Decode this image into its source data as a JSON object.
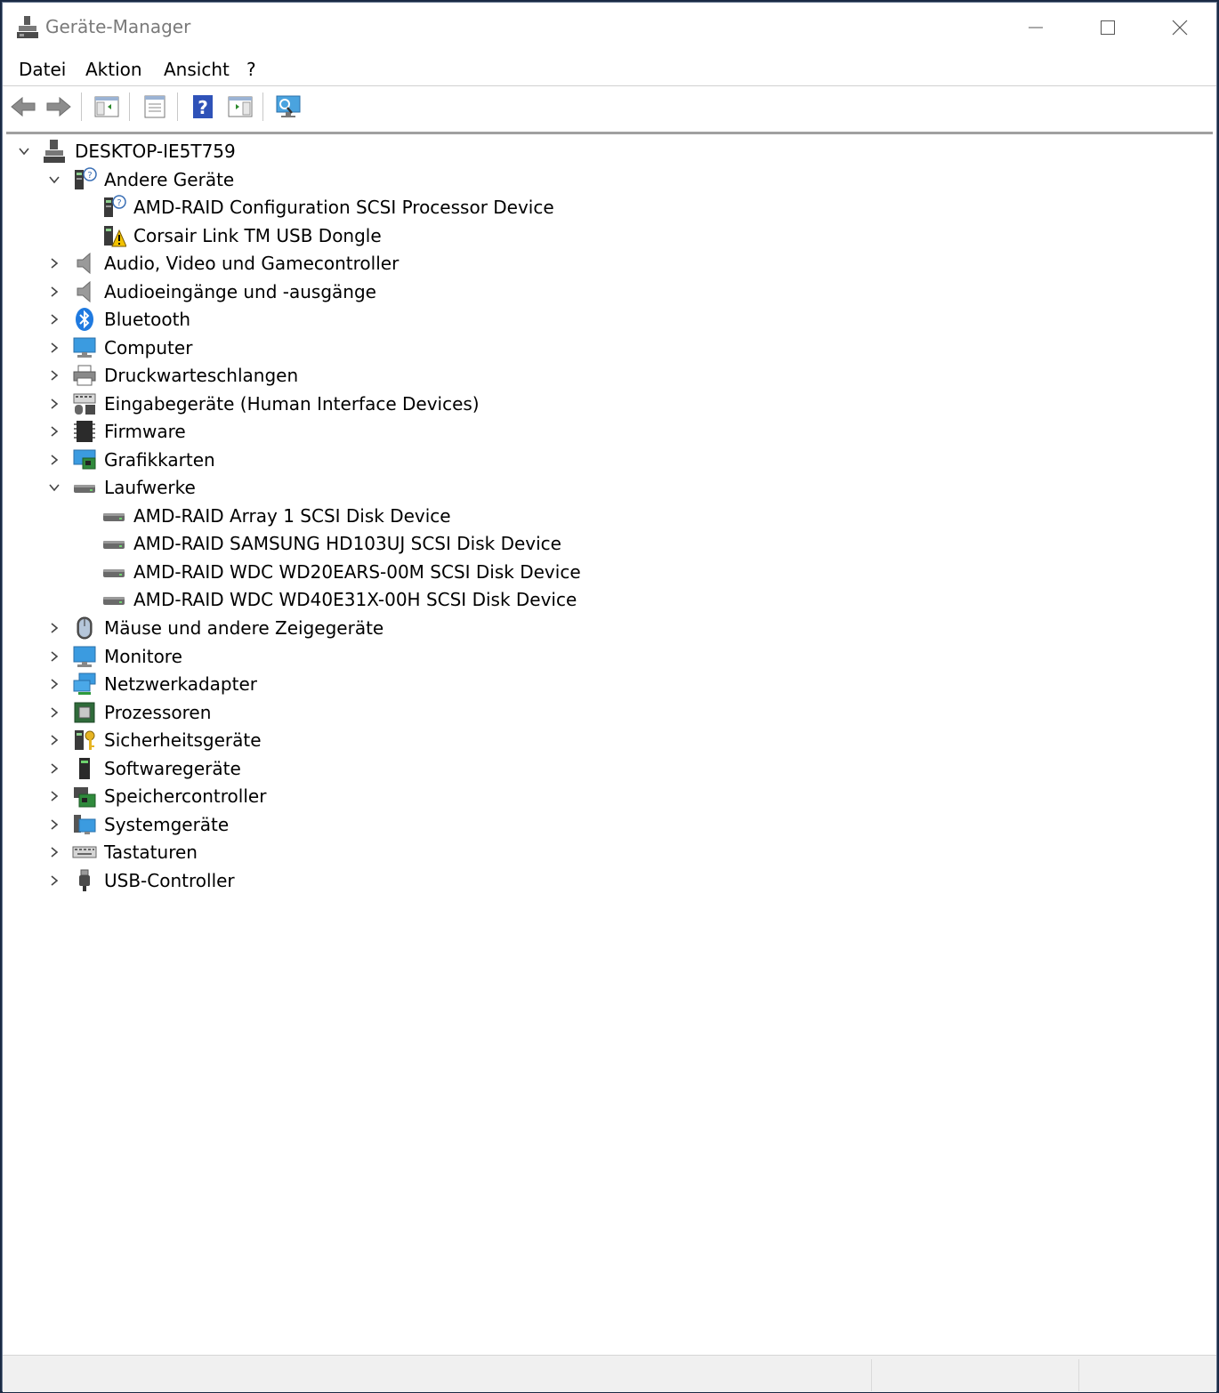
{
  "window": {
    "title": "Geräte-Manager"
  },
  "menu": {
    "items": [
      "Datei",
      "Aktion",
      "Ansicht",
      "?"
    ]
  },
  "toolbar": {
    "buttons": [
      "back-icon",
      "forward-icon",
      "show-hide-console-tree-icon",
      "properties-icon",
      "help-icon",
      "action-pane-icon",
      "scan-hardware-icon"
    ]
  },
  "tree": {
    "root": "DESKTOP-IE5T759",
    "nodes": [
      {
        "label": "Andere Geräte",
        "expanded": true,
        "icon": "unknown-device-icon",
        "children": [
          {
            "label": "AMD-RAID Configuration SCSI Processor Device",
            "icon": "unknown-device-icon"
          },
          {
            "label": "Corsair Link TM USB Dongle",
            "icon": "warning-device-icon"
          }
        ]
      },
      {
        "label": "Audio, Video und Gamecontroller",
        "icon": "speaker-icon"
      },
      {
        "label": "Audioeingänge und -ausgänge",
        "icon": "speaker-icon"
      },
      {
        "label": "Bluetooth",
        "icon": "bluetooth-icon"
      },
      {
        "label": "Computer",
        "icon": "computer-icon"
      },
      {
        "label": "Druckwarteschlangen",
        "icon": "printer-icon"
      },
      {
        "label": "Eingabegeräte (Human Interface Devices)",
        "icon": "hid-icon"
      },
      {
        "label": "Firmware",
        "icon": "firmware-icon"
      },
      {
        "label": "Grafikkarten",
        "icon": "display-adapter-icon"
      },
      {
        "label": "Laufwerke",
        "expanded": true,
        "icon": "disk-drive-icon",
        "children": [
          {
            "label": "AMD-RAID Array 1  SCSI Disk Device",
            "icon": "disk-drive-icon"
          },
          {
            "label": "AMD-RAID SAMSUNG HD103UJ SCSI Disk Device",
            "icon": "disk-drive-icon"
          },
          {
            "label": "AMD-RAID WDC WD20EARS-00M SCSI Disk Device",
            "icon": "disk-drive-icon"
          },
          {
            "label": "AMD-RAID WDC WD40E31X-00H SCSI Disk Device",
            "icon": "disk-drive-icon"
          }
        ]
      },
      {
        "label": "Mäuse und andere Zeigegeräte",
        "icon": "mouse-icon"
      },
      {
        "label": "Monitore",
        "icon": "monitor-icon"
      },
      {
        "label": "Netzwerkadapter",
        "icon": "network-adapter-icon"
      },
      {
        "label": "Prozessoren",
        "icon": "processor-icon"
      },
      {
        "label": "Sicherheitsgeräte",
        "icon": "security-device-icon"
      },
      {
        "label": "Softwaregeräte",
        "icon": "software-device-icon"
      },
      {
        "label": "Speichercontroller",
        "icon": "storage-controller-icon"
      },
      {
        "label": "Systemgeräte",
        "icon": "system-device-icon"
      },
      {
        "label": "Tastaturen",
        "icon": "keyboard-icon"
      },
      {
        "label": "USB-Controller",
        "icon": "usb-icon"
      }
    ]
  }
}
